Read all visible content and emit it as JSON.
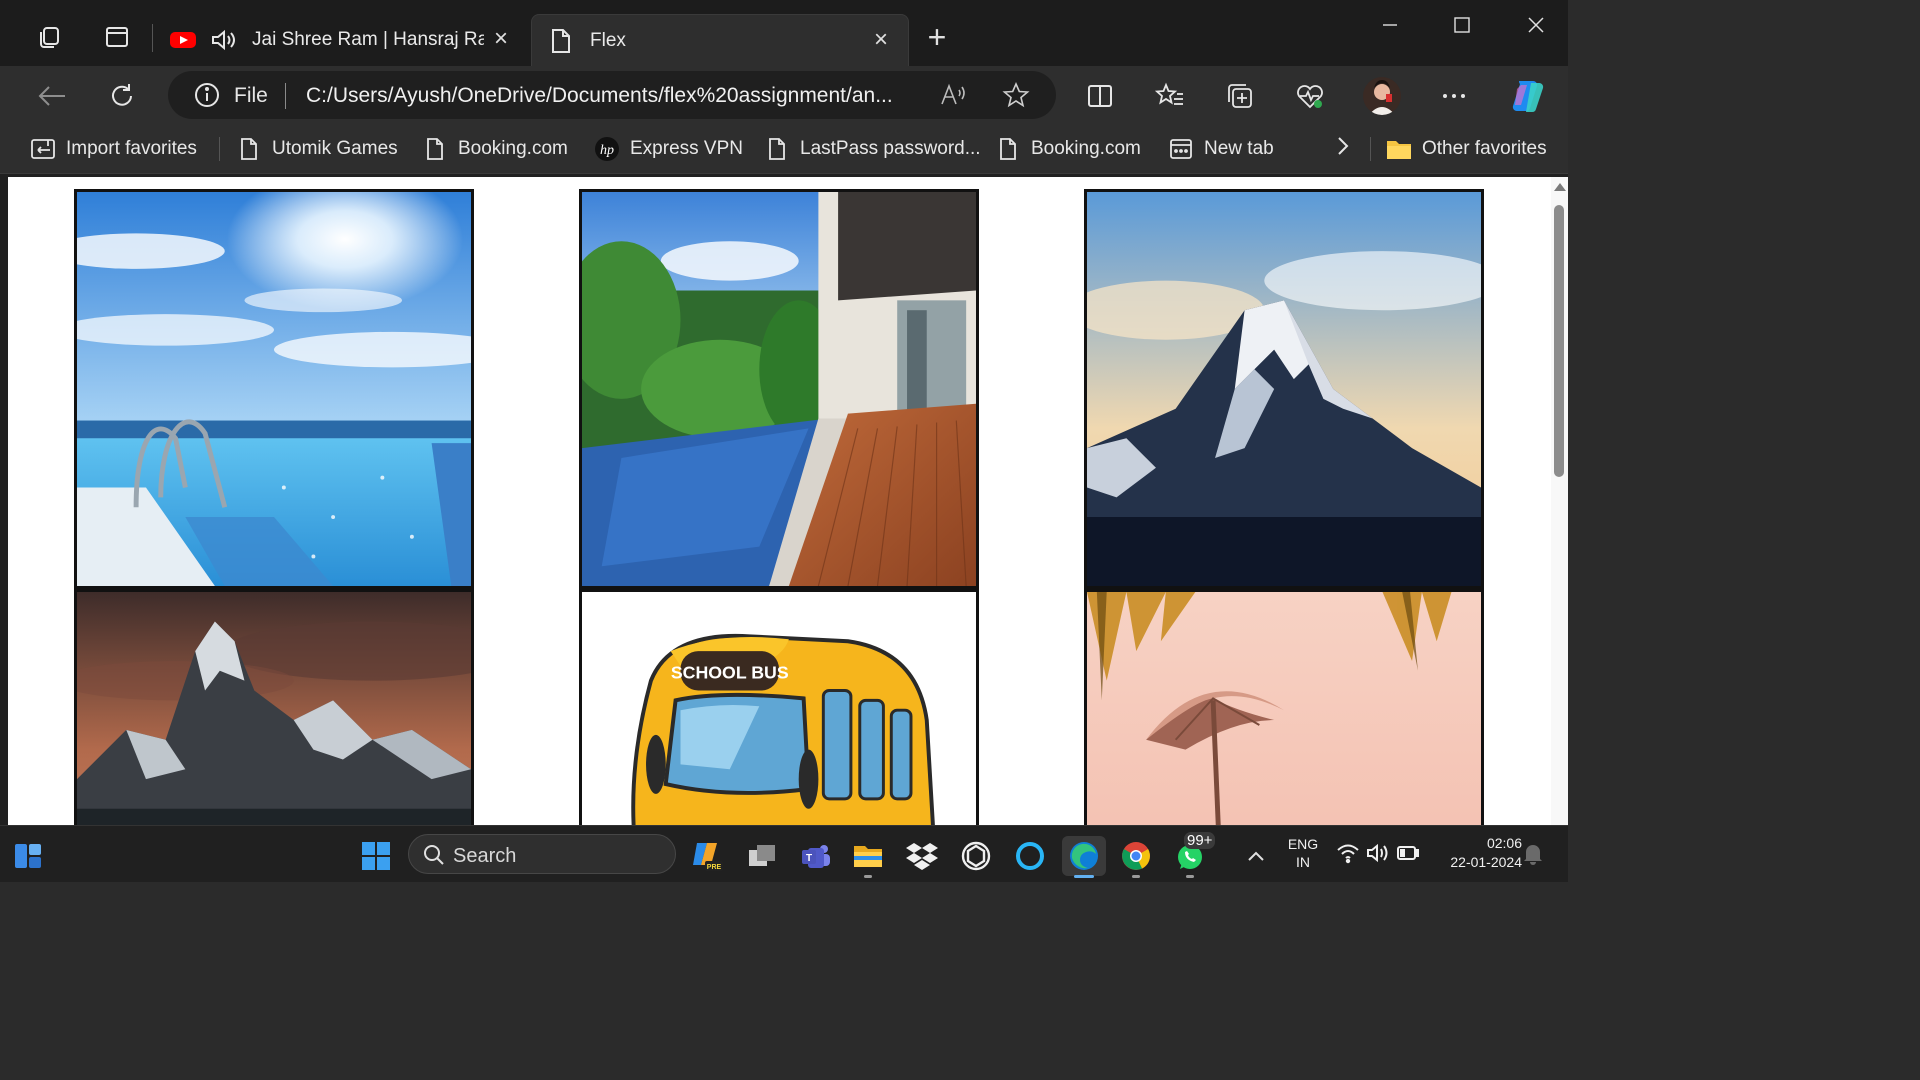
{
  "tabs": [
    {
      "label": "Jai Shree Ram | Hansraj Rag",
      "icon": "youtube-icon"
    },
    {
      "label": "Flex",
      "icon": "page-icon"
    }
  ],
  "address": {
    "scheme": "File",
    "url": "C:/Users/Ayush/OneDrive/Documents/flex%20assignment/an..."
  },
  "favorites": [
    {
      "label": "Import favorites",
      "icon": "import-icon"
    },
    {
      "label": "Utomik Games",
      "icon": "page-icon"
    },
    {
      "label": "Booking.com",
      "icon": "page-icon"
    },
    {
      "label": "Express VPN",
      "icon": "hp-icon"
    },
    {
      "label": "LastPass password...",
      "icon": "page-icon"
    },
    {
      "label": "Booking.com",
      "icon": "page-icon"
    },
    {
      "label": "New tab",
      "icon": "newtab-icon"
    }
  ],
  "other_favorites": "Other favorites",
  "gallery": [
    {
      "name": "pool-sky-image"
    },
    {
      "name": "villa-pool-image"
    },
    {
      "name": "mountain-peak-image"
    },
    {
      "name": "mountain-range-image"
    },
    {
      "name": "school-bus-image",
      "text": "SCHOOL BUS"
    },
    {
      "name": "beach-umbrella-image"
    }
  ],
  "taskbar": {
    "search_placeholder": "Search",
    "badge": "99+",
    "lang_top": "ENG",
    "lang_bottom": "IN",
    "time": "02:06",
    "date": "22-01-2024"
  },
  "colors": {
    "tab_active": "#2e2e2e",
    "chrome_dark": "#1c1c1c",
    "content_bg": "#ffffff",
    "taskbar": "#202020"
  }
}
